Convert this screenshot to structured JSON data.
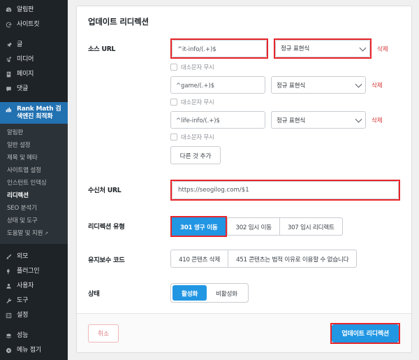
{
  "sidebar": {
    "items": [
      {
        "label": "알림판",
        "icon": "dashboard-icon",
        "active": false
      },
      {
        "label": "사이트킷",
        "icon": "google-g-icon",
        "active": false
      },
      {
        "label": "글",
        "icon": "pin-icon",
        "active": false
      },
      {
        "label": "미디어",
        "icon": "media-icon",
        "active": false
      },
      {
        "label": "페이지",
        "icon": "page-icon",
        "active": false
      },
      {
        "label": "댓글",
        "icon": "comment-icon",
        "active": false
      },
      {
        "label": "Rank Math 검색엔진 최적화",
        "icon": "rankmath-icon",
        "active": true
      }
    ],
    "submenu": [
      {
        "label": "알림판",
        "current": false
      },
      {
        "label": "일반 설정",
        "current": false
      },
      {
        "label": "제목 및 메타",
        "current": false
      },
      {
        "label": "사이트맵 설정",
        "current": false
      },
      {
        "label": "인스턴트 인덱싱",
        "current": false
      },
      {
        "label": "리디렉션",
        "current": true
      },
      {
        "label": "SEO 분석기",
        "current": false
      },
      {
        "label": "상태 및 도구",
        "current": false
      },
      {
        "label": "도움말 및 지원",
        "current": false,
        "external": true
      }
    ],
    "items_bottom": [
      {
        "label": "외모",
        "icon": "appearance-brush-icon"
      },
      {
        "label": "플러그인",
        "icon": "plugin-icon"
      },
      {
        "label": "사용자",
        "icon": "user-icon"
      },
      {
        "label": "도구",
        "icon": "wrench-icon"
      },
      {
        "label": "설정",
        "icon": "settings-sliders-icon"
      }
    ],
    "items_footer": [
      {
        "label": "성능",
        "icon": "performance-icon"
      },
      {
        "label": "메뉴 접기",
        "icon": "collapse-menu-icon"
      }
    ]
  },
  "card": {
    "title": "업데이트 리디렉션",
    "source_url": {
      "label": "소스 URL",
      "rows": [
        {
          "value": "^it-info/(.+)$",
          "match_type": "정규 표현식",
          "delete_label": "삭제",
          "ignore_case_label": "대소문자 무시",
          "ignore_case_checked": false,
          "highlighted": true
        },
        {
          "value": "^game/(.+)$",
          "match_type": "정규 표현식",
          "delete_label": "삭제",
          "ignore_case_label": "대소문자 무시",
          "ignore_case_checked": false,
          "highlighted": false
        },
        {
          "value": "^life-info/(.+)$",
          "match_type": "정규 표현식",
          "delete_label": "삭제",
          "ignore_case_label": "대소문자 무시",
          "ignore_case_checked": false,
          "highlighted": false
        }
      ],
      "add_another_label": "다른 것 추가"
    },
    "destination_url": {
      "label": "수신처 URL",
      "value": "https://seogilog.com/$1",
      "highlighted": true
    },
    "redirection_type": {
      "label": "리디렉션 유형",
      "options": [
        {
          "label": "301 영구 이동",
          "selected": true,
          "highlighted": true
        },
        {
          "label": "302 임시 이동",
          "selected": false,
          "highlighted": false
        },
        {
          "label": "307 임시 리디렉트",
          "selected": false,
          "highlighted": false
        }
      ]
    },
    "maintenance_code": {
      "label": "유지보수 코드",
      "options": [
        {
          "label": "410 콘텐츠 삭제",
          "selected": false
        },
        {
          "label": "451 콘텐츠는 법적 이유로 이용할 수 없습니다",
          "selected": false
        }
      ]
    },
    "status": {
      "label": "상태",
      "options": [
        {
          "label": "활성화",
          "selected": true
        },
        {
          "label": "비활성화",
          "selected": false
        }
      ]
    },
    "footer": {
      "cancel_label": "취소",
      "submit_label": "업데이트 리디렉션",
      "submit_highlighted": true
    }
  },
  "colors": {
    "sidebar_bg": "#1d2327",
    "submenu_bg": "#2c3338",
    "accent_blue": "#2196e3",
    "active_blue": "#2271b1",
    "highlight_red": "#e8252a",
    "delete_red": "#d63638"
  }
}
